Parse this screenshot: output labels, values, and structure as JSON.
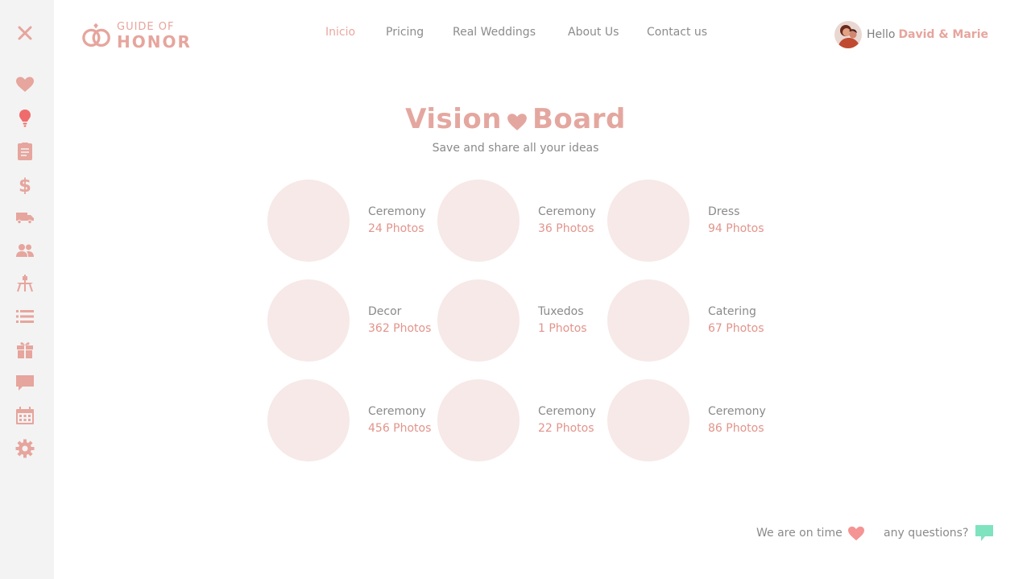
{
  "app": {
    "brand_line1": "GUIDE OF",
    "brand_line2": "HONOR",
    "accent_color": "#e6a59d",
    "icon_red": "#f06b6b"
  },
  "nav": {
    "items": [
      {
        "label": "Inicio",
        "active": true
      },
      {
        "label": "Pricing",
        "active": false
      },
      {
        "label": "Real Weddings",
        "active": false
      },
      {
        "label": "About Us",
        "active": false
      },
      {
        "label": "Contact us",
        "active": false
      }
    ]
  },
  "user": {
    "greeting": "Hello",
    "name": "David & Marie"
  },
  "sidebar": {
    "icons": [
      "close-icon",
      "heart-icon",
      "lightbulb-icon",
      "clipboard-icon",
      "dollar-icon",
      "truck-icon",
      "guests-icon",
      "cake-table-icon",
      "list-icon",
      "gift-icon",
      "chat-icon",
      "calendar-icon",
      "gear-icon"
    ],
    "active_icon": "lightbulb-icon"
  },
  "page": {
    "title_part1": "Vision",
    "title_part2": "Board",
    "subtitle": "Save and share all your ideas"
  },
  "board": {
    "cards": [
      {
        "label": "Ceremony",
        "count": "24 Photos"
      },
      {
        "label": "Ceremony",
        "count": "36 Photos"
      },
      {
        "label": "Dress",
        "count": "94 Photos"
      },
      {
        "label": "Decor",
        "count": "362 Photos"
      },
      {
        "label": "Tuxedos",
        "count": "1 Photos"
      },
      {
        "label": "Catering",
        "count": "67 Photos"
      },
      {
        "label": "Ceremony",
        "count": "456 Photos"
      },
      {
        "label": "Ceremony",
        "count": "22 Photos"
      },
      {
        "label": "Ceremony",
        "count": "86 Photos"
      }
    ]
  },
  "footer": {
    "on_time": "We are on time",
    "questions": "any questions?",
    "heart_color": "#f59494",
    "chat_color": "#7fe3bf"
  }
}
